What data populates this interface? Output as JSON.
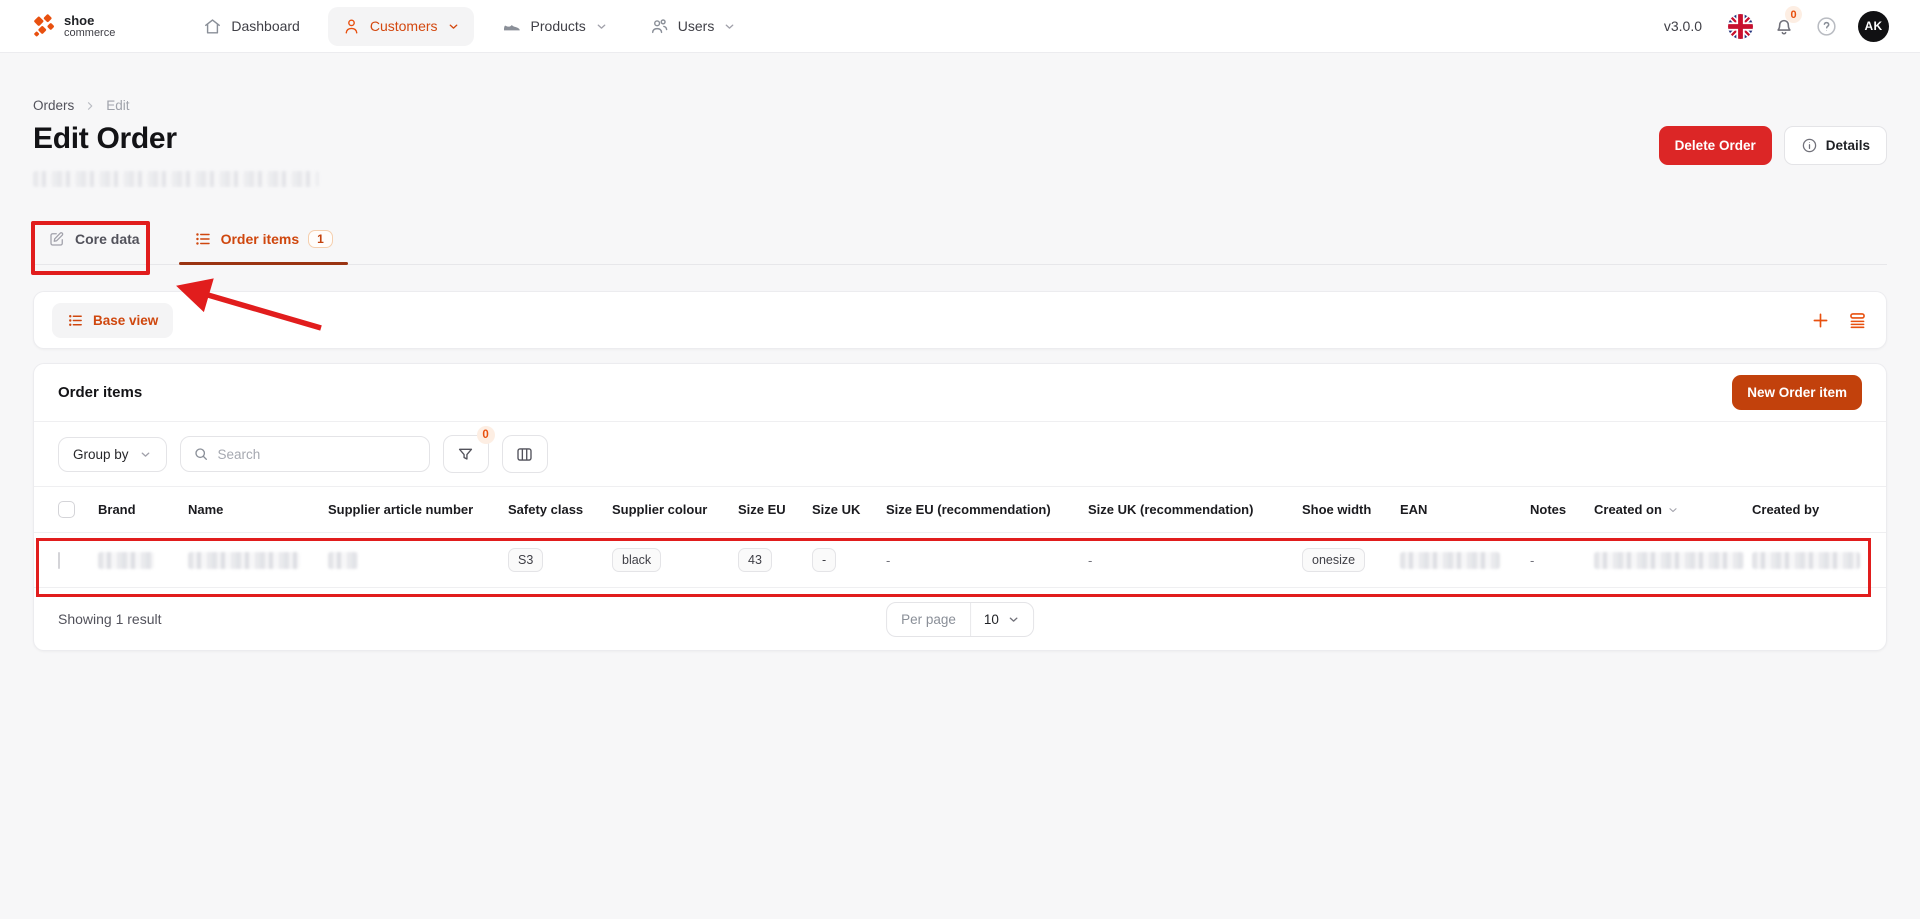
{
  "brand": {
    "line1": "shoe",
    "line2": "commerce"
  },
  "nav": {
    "dashboard": "Dashboard",
    "customers": "Customers",
    "products": "Products",
    "users": "Users"
  },
  "topbar": {
    "version": "v3.0.0",
    "notifications_badge": "0",
    "avatar_initials": "AK"
  },
  "breadcrumb": {
    "parent": "Orders",
    "current": "Edit"
  },
  "page": {
    "title": "Edit Order"
  },
  "header_actions": {
    "delete": "Delete Order",
    "details": "Details"
  },
  "tabs": {
    "core_data": "Core data",
    "order_items": "Order items",
    "order_items_badge": "1"
  },
  "view_bar": {
    "base_view": "Base view"
  },
  "panel": {
    "title": "Order items",
    "new_item": "New Order item"
  },
  "controls": {
    "group_by": "Group by",
    "search_placeholder": "Search",
    "filter_badge": "0"
  },
  "table": {
    "columns": [
      "Brand",
      "Name",
      "Supplier article number",
      "Safety class",
      "Supplier colour",
      "Size EU",
      "Size UK",
      "Size EU (recommendation)",
      "Size UK (recommendation)",
      "Shoe width",
      "EAN",
      "Notes",
      "Created on",
      "Created by"
    ],
    "row": {
      "safety_class": "S3",
      "supplier_colour": "black",
      "size_eu": "43",
      "size_uk": "-",
      "size_eu_rec": "-",
      "size_uk_rec": "-",
      "shoe_width": "onesize",
      "notes": "-"
    }
  },
  "footer": {
    "summary": "Showing 1 result",
    "per_page_label": "Per page",
    "per_page_value": "10"
  },
  "colors": {
    "accent": "#e8500f",
    "accent_text": "#cf470e",
    "tab_underline": "#9a3412",
    "new_button": "#c2410c",
    "delete_button": "#dc2626",
    "annotation": "#e11d1d"
  }
}
